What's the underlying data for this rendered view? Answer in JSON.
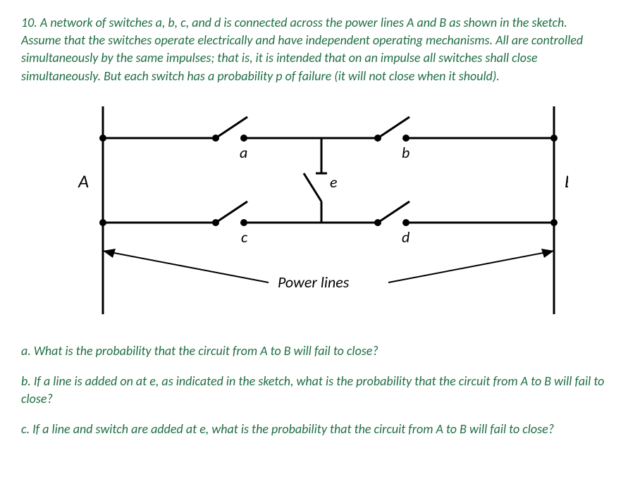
{
  "problem": {
    "statement": "10. A network of switches a, b, c, and d is connected across the power lines A and B as shown in the sketch. Assume that the switches operate electrically and have independent operating mechanisms. All are controlled simultaneously by the same impulses; that is, it is intended that on an impulse all switches shall close simultaneously. But each switch has a probability p of failure (it will not close when it should)."
  },
  "diagram": {
    "labels": {
      "left_terminal": "A",
      "right_terminal": "B",
      "switch_top_left": "a",
      "switch_top_right": "b",
      "switch_bottom_left": "c",
      "switch_bottom_right": "d",
      "switch_middle": "e",
      "footer": "Power lines"
    }
  },
  "questions": {
    "a": "a. What is the probability that the circuit from A to B will fail to close?",
    "b": "b. If a line is added on at e, as indicated in the sketch, what is the probability that the circuit from A to B will fail to close?",
    "c": "c. If a line and switch are added at e, what is the probability that the circuit from A to B will fail to close?"
  }
}
